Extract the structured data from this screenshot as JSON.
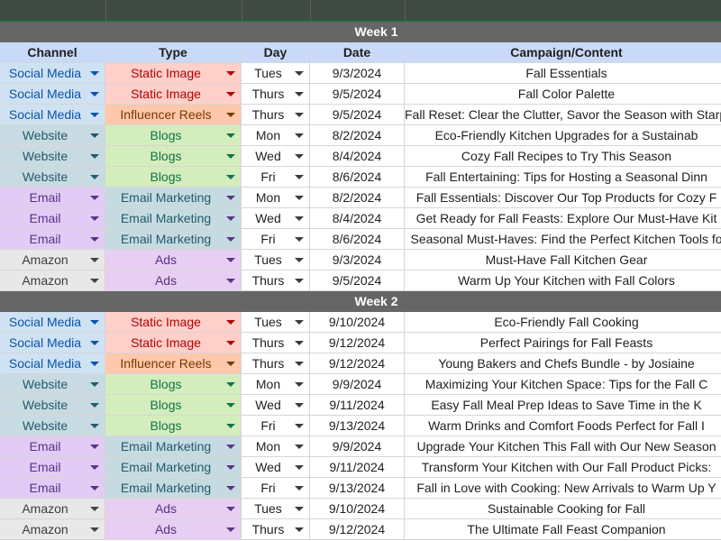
{
  "colors": {
    "social_media": "#cfe2f3",
    "website": "#c9dbe2",
    "email": "#e2ccf5",
    "amazon": "#e8e8e8",
    "static_image": "#ffcfc9",
    "influencer_reels": "#ffc8aa",
    "blogs": "#d4edbc",
    "email_marketing": "#c6dbe1",
    "ads": "#e6cff2",
    "text_social": "#0a53a8",
    "text_static": "#b10202",
    "text_influencer": "#753800",
    "text_blogs": "#11734b",
    "text_website": "#215a6c",
    "text_email": "#5a3286",
    "text_amazon": "#3d3d3d",
    "arrow_social": "#0a53a8",
    "arrow_static": "#b10202",
    "arrow_influencer": "#753800",
    "arrow_blogs": "#11734b",
    "arrow_website": "#215a6c",
    "arrow_email": "#5a3286",
    "arrow_ads": "#5a3286",
    "arrow_amazon": "#444444"
  },
  "headers": {
    "channel": "Channel",
    "type": "Type",
    "day": "Day",
    "date": "Date",
    "campaign": "Campaign/Content"
  },
  "weeks": [
    {
      "label": "Week 1",
      "rows": [
        {
          "channel": "Social Media",
          "type": "Static Image",
          "day": "Tues",
          "date": "9/3/2024",
          "campaign": "Fall Essentials"
        },
        {
          "channel": "Social Media",
          "type": "Static Image",
          "day": "Thurs",
          "date": "9/5/2024",
          "campaign": "Fall Color Palette"
        },
        {
          "channel": "Social Media",
          "type": "Influencer Reels",
          "day": "Thurs",
          "date": "9/5/2024",
          "campaign": "Fall Reset: Clear the Clutter, Savor the Season with Starpa"
        },
        {
          "channel": "Website",
          "type": "Blogs",
          "day": "Mon",
          "date": "8/2/2024",
          "campaign": "Eco-Friendly Kitchen Upgrades for a Sustainab"
        },
        {
          "channel": "Website",
          "type": "Blogs",
          "day": "Wed",
          "date": "8/4/2024",
          "campaign": "Cozy Fall Recipes to Try This Season"
        },
        {
          "channel": "Website",
          "type": "Blogs",
          "day": "Fri",
          "date": "8/6/2024",
          "campaign": "Fall Entertaining: Tips for Hosting a Seasonal Dinn"
        },
        {
          "channel": "Email",
          "type": "Email Marketing",
          "day": "Mon",
          "date": "8/2/2024",
          "campaign": "Fall Essentials: Discover Our Top Products for Cozy F"
        },
        {
          "channel": "Email",
          "type": "Email Marketing",
          "day": "Wed",
          "date": "8/4/2024",
          "campaign": "Get Ready for Fall Feasts: Explore Our Must-Have Kit"
        },
        {
          "channel": "Email",
          "type": "Email Marketing",
          "day": "Fri",
          "date": "8/6/2024",
          "campaign": "Seasonal Must-Haves: Find the Perfect Kitchen Tools fo"
        },
        {
          "channel": "Amazon",
          "type": "Ads",
          "day": "Tues",
          "date": "9/3/2024",
          "campaign": "Must-Have Fall Kitchen Gear"
        },
        {
          "channel": "Amazon",
          "type": "Ads",
          "day": "Thurs",
          "date": "9/5/2024",
          "campaign": "Warm Up Your Kitchen with Fall Colors"
        }
      ]
    },
    {
      "label": "Week 2",
      "rows": [
        {
          "channel": "Social Media",
          "type": "Static Image",
          "day": "Tues",
          "date": "9/10/2024",
          "campaign": "Eco-Friendly Fall Cooking"
        },
        {
          "channel": "Social Media",
          "type": "Static Image",
          "day": "Thurs",
          "date": "9/12/2024",
          "campaign": "Perfect Pairings for Fall Feasts"
        },
        {
          "channel": "Social Media",
          "type": "Influencer Reels",
          "day": "Thurs",
          "date": "9/12/2024",
          "campaign": "Young Bakers and Chefs Bundle - by Josiaine"
        },
        {
          "channel": "Website",
          "type": "Blogs",
          "day": "Mon",
          "date": "9/9/2024",
          "campaign": "Maximizing Your Kitchen Space: Tips for the Fall C"
        },
        {
          "channel": "Website",
          "type": "Blogs",
          "day": "Wed",
          "date": "9/11/2024",
          "campaign": "Easy Fall Meal Prep Ideas to Save Time in the K"
        },
        {
          "channel": "Website",
          "type": "Blogs",
          "day": "Fri",
          "date": "9/13/2024",
          "campaign": "Warm Drinks and Comfort Foods Perfect for Fall I"
        },
        {
          "channel": "Email",
          "type": "Email Marketing",
          "day": "Mon",
          "date": "9/9/2024",
          "campaign": "Upgrade Your Kitchen This Fall with Our New Season"
        },
        {
          "channel": "Email",
          "type": "Email Marketing",
          "day": "Wed",
          "date": "9/11/2024",
          "campaign": "Transform Your Kitchen with Our Fall Product Picks:"
        },
        {
          "channel": "Email",
          "type": "Email Marketing",
          "day": "Fri",
          "date": "9/13/2024",
          "campaign": "Fall in Love with Cooking: New Arrivals to Warm Up Y"
        },
        {
          "channel": "Amazon",
          "type": "Ads",
          "day": "Tues",
          "date": "9/10/2024",
          "campaign": "Sustainable Cooking for Fall"
        },
        {
          "channel": "Amazon",
          "type": "Ads",
          "day": "Thurs",
          "date": "9/12/2024",
          "campaign": "The Ultimate Fall Feast Companion"
        }
      ]
    }
  ]
}
